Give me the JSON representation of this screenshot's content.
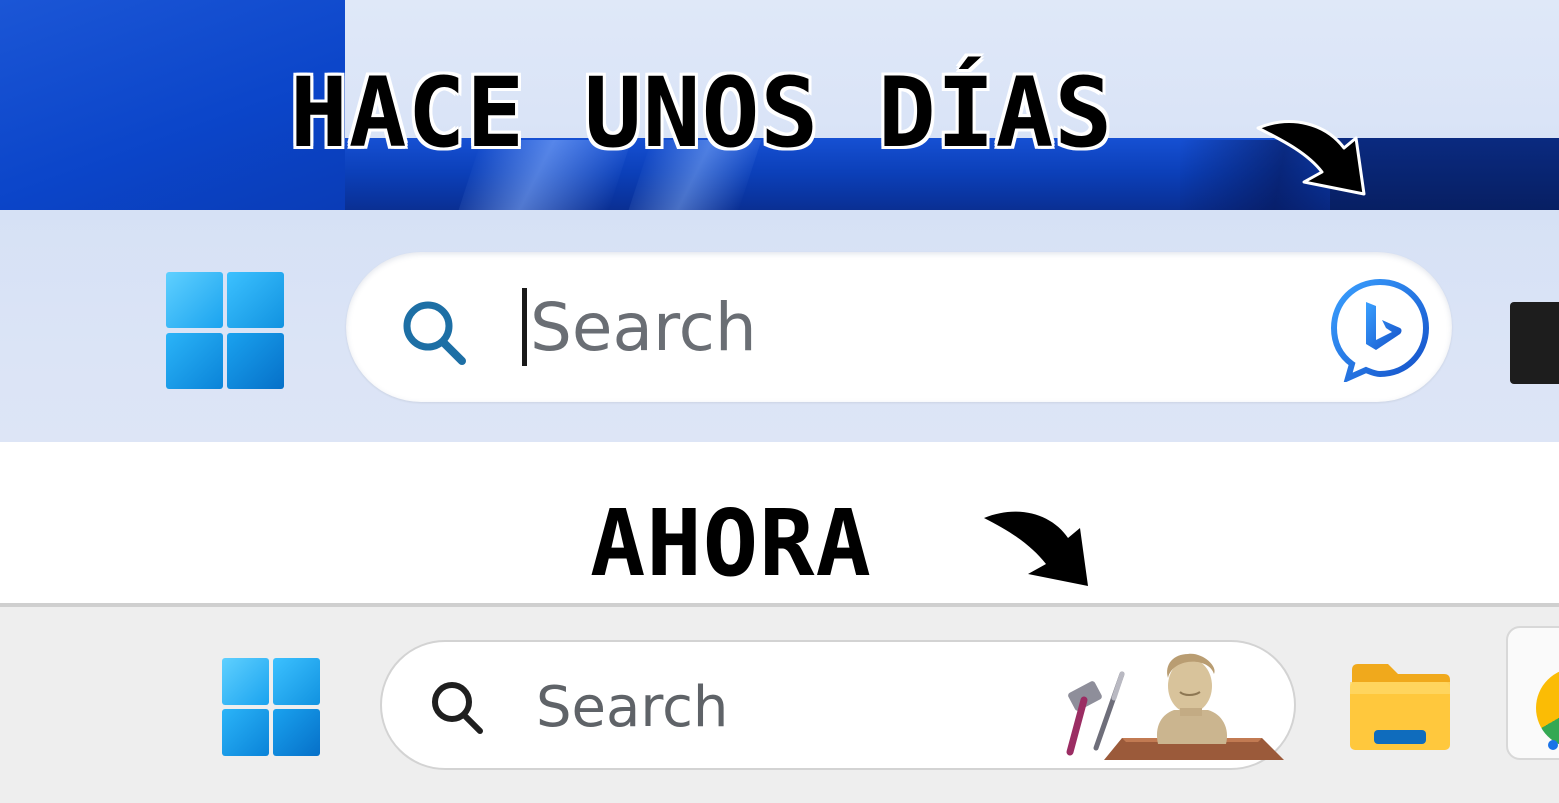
{
  "captions": {
    "before": "HACE UNOS DÍAS",
    "after": "AHORA"
  },
  "old_taskbar": {
    "search_placeholder": "Search",
    "start_icon": "windows-logo-icon",
    "search_icon": "search-icon",
    "bing_icon": "bing-chat-icon"
  },
  "new_taskbar": {
    "search_placeholder": "Search",
    "start_icon": "windows-logo-icon",
    "search_icon": "search-icon",
    "search_highlight_icon": "sculptor-statue-highlight-icon",
    "pinned_apps": [
      "file-explorer-icon",
      "chrome-icon"
    ]
  },
  "colors": {
    "windows_blue": "#1e9be9",
    "bing_blue": "#1560d4",
    "caption_text": "#000000"
  }
}
